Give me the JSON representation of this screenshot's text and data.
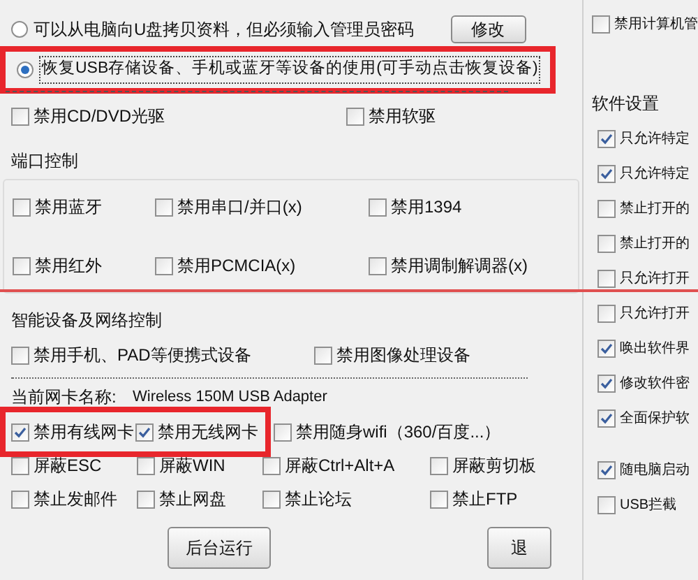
{
  "usb_options": [
    {
      "label": "可以从电脑向U盘拷贝资料，但必须输入管理员密码",
      "selected": false,
      "highlighted": false,
      "button": "修改"
    },
    {
      "label": "恢复USB存储设备、手机或蓝牙等设备的使用(可手动点击恢复设备)",
      "selected": true,
      "highlighted": true
    }
  ],
  "drives": [
    {
      "label": "禁用CD/DVD光驱",
      "checked": false
    },
    {
      "label": "禁用软驱",
      "checked": false
    }
  ],
  "port_control": {
    "title": "端口控制",
    "rows": [
      [
        {
          "label": "禁用蓝牙",
          "checked": false
        },
        {
          "label": "禁用串口/并口(x)",
          "checked": false
        },
        {
          "label": "禁用1394",
          "checked": false
        }
      ],
      [
        {
          "label": "禁用红外",
          "checked": false
        },
        {
          "label": "禁用PCMCIA(x)",
          "checked": false
        },
        {
          "label": "禁用调制解调器(x)",
          "checked": false
        }
      ]
    ]
  },
  "annotation_line": true,
  "smart_devices": {
    "title": "智能设备及网络控制",
    "items": [
      {
        "label": "禁用手机、PAD等便携式设备",
        "checked": false
      },
      {
        "label": "禁用图像处理设备",
        "checked": false
      }
    ]
  },
  "network": {
    "label": "当前网卡名称:",
    "adapter": "Wireless 150M USB Adapter",
    "rows": [
      {
        "highlighted": [
          {
            "label": "禁用有线网卡",
            "checked": true
          },
          {
            "label": "禁用无线网卡",
            "checked": true
          }
        ],
        "items": [
          {
            "label": "禁用随身wifi（360/百度...）",
            "checked": false
          }
        ]
      },
      {
        "highlighted": [],
        "items": [
          {
            "label": "屏蔽ESC",
            "checked": false
          },
          {
            "label": "屏蔽WIN",
            "checked": false
          },
          {
            "label": "屏蔽Ctrl+Alt+A",
            "checked": false
          },
          {
            "label": "屏蔽剪切板",
            "checked": false
          }
        ]
      },
      {
        "highlighted": [],
        "items": [
          {
            "label": "禁止发邮件",
            "checked": false
          },
          {
            "label": "禁止网盘",
            "checked": false
          },
          {
            "label": "禁止论坛",
            "checked": false
          },
          {
            "label": "禁止FTP",
            "checked": false
          }
        ]
      }
    ]
  },
  "buttons": [
    "后台运行",
    "退"
  ],
  "software": {
    "top_item": {
      "label": "禁用计算机管",
      "checked": false
    },
    "title": "软件设置",
    "items": [
      {
        "label": "只允许特定",
        "checked": true
      },
      {
        "label": "只允许特定",
        "checked": true
      },
      {
        "label": "禁止打开的",
        "checked": false
      },
      {
        "label": "禁止打开的",
        "checked": false
      },
      {
        "label": "只允许打开",
        "checked": false
      },
      {
        "label": "只允许打开",
        "checked": false
      },
      {
        "label": "唤出软件界",
        "checked": true
      },
      {
        "label": "修改软件密",
        "checked": true
      },
      {
        "label": "全面保护软",
        "checked": true
      },
      {
        "label": "随电脑启动",
        "checked": true
      },
      {
        "label": "USB拦截",
        "checked": false
      }
    ]
  }
}
